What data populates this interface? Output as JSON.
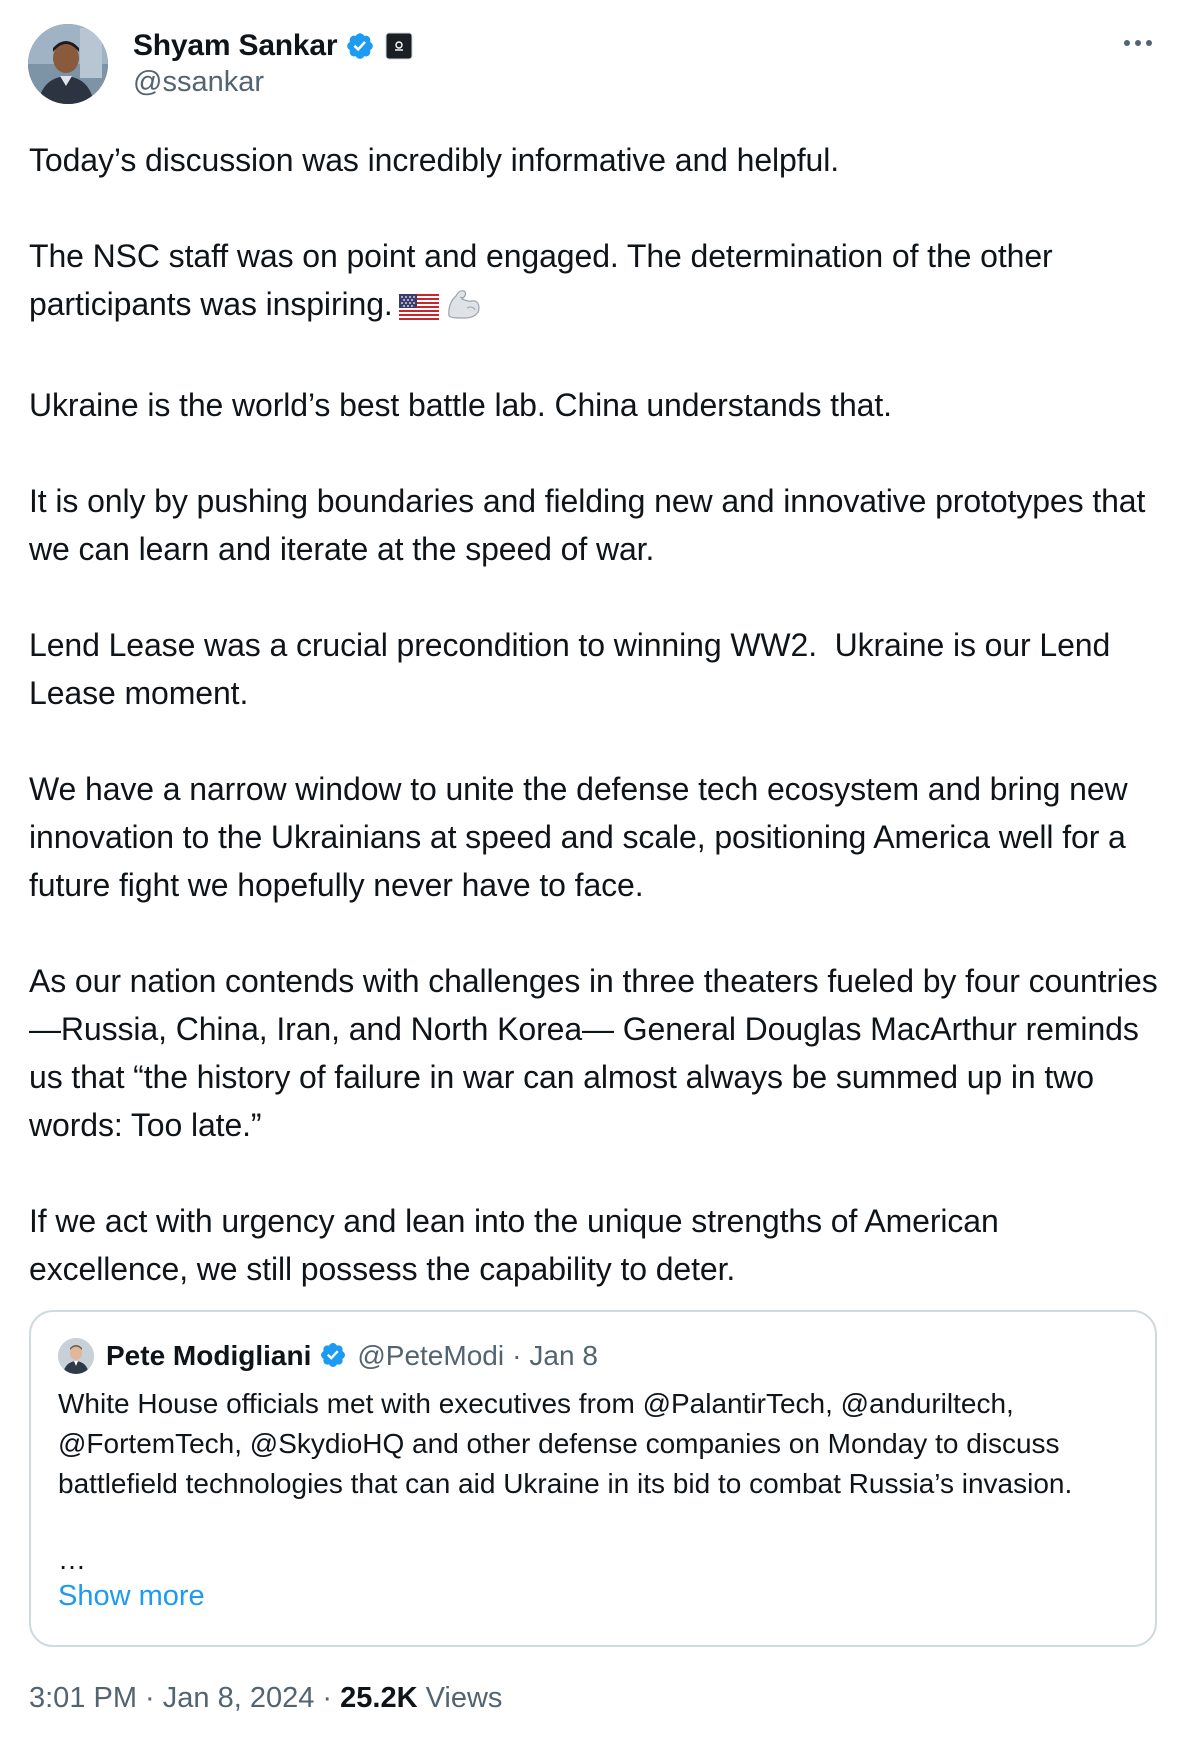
{
  "author": {
    "display_name": "Shyam Sankar",
    "handle": "@ssankar",
    "avatar_icon": "profile-photo",
    "verified_icon": "verified-badge-icon",
    "affiliate_icon": "affiliate-badge-icon"
  },
  "menu_icon": "more-options-icon",
  "colors": {
    "text": "#0f1419",
    "secondary": "#536471",
    "link": "#1d9bf0",
    "verified": "#1d9bf0",
    "border": "#cfd9de"
  },
  "body": {
    "paragraphs": [
      "Today’s discussion was incredibly informative and helpful.",
      "The NSC staff was on point and engaged. The determination of the other participants was inspiring.",
      "Ukraine is the world’s best battle lab. China understands that.",
      "It is only by pushing boundaries and fielding new and innovative prototypes that we can learn and iterate at the speed of war.",
      "Lend Lease was a crucial precondition to winning WW2.  Ukraine is our Lend Lease moment.",
      "We have a narrow window to unite the defense tech ecosystem and bring new innovation to the Ukrainians at speed and scale, positioning America well for a future fight we hopefully never have to face.",
      "As our nation contends with challenges in three theaters fueled by four countries —Russia, China, Iran, and North Korea— General Douglas MacArthur reminds us that “the history of failure in war can almost always be summed up in two words: Too late.”",
      "If we act with urgency and lean into the unique strengths of American excellence, we still possess the capability to deter."
    ],
    "emojis": [
      "us-flag-emoji",
      "flexed-biceps-emoji"
    ]
  },
  "quote": {
    "display_name": "Pete Modigliani",
    "handle": "@PeteModi",
    "separator": "·",
    "date": "Jan 8",
    "text": "White House officials met with executives from @PalantirTech, @anduriltech, @FortemTech, @SkydioHQ and other defense companies on Monday to discuss battlefield technologies that can aid Ukraine in its bid to combat Russia’s invasion.",
    "ellipsis": "…",
    "show_more": "Show more"
  },
  "meta": {
    "time": "3:01 PM",
    "sep1": " · ",
    "date": "Jan 8, 2024",
    "sep2": " · ",
    "views_count": "25.2K",
    "views_label": " Views"
  }
}
